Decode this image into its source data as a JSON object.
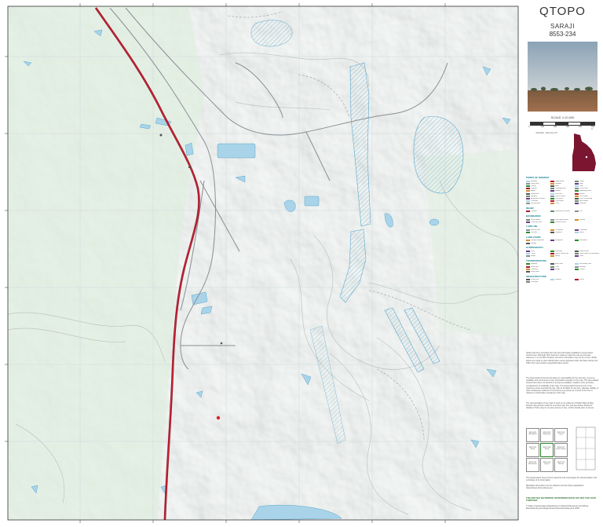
{
  "brand": {
    "title": "QTOPO",
    "map_name": "SARAJI",
    "map_code": "8553-234"
  },
  "scale": {
    "label": "SCALE 1:10,000",
    "ticks": [
      "0",
      "100",
      "200",
      "300",
      "400",
      "500 m"
    ]
  },
  "legend": {
    "sections": [
      {
        "heading": "POINTS OF INTEREST",
        "items": [
          "Building",
          "Homestead",
          "Tower",
          "Water tank",
          "Windmill",
          "Mine",
          "Quarry",
          "Bore",
          "Dam",
          "Lookout",
          "Camping area",
          "Picnic area",
          "Airport",
          "Helipad",
          "Landing ground",
          "Lighthouse",
          "Rest area",
          "School",
          "Hospital",
          "Police station",
          "Fire station",
          "Ambulance station",
          "Post office",
          "Place of worship",
          "Cemetery",
          "Trig station",
          "Spot height",
          "Survey mark",
          "Cave",
          "Waterfall"
        ]
      },
      {
        "heading": "RELIEF",
        "items": [
          "Contour",
          "Depression contour",
          "Cliff"
        ]
      },
      {
        "heading": "BOUNDARIES",
        "items": [
          "State border",
          "Local government",
          "Locality",
          "Protected area",
          "Forest reserve"
        ]
      },
      {
        "heading": "LAND USE",
        "items": [
          "Built-up area",
          "Cultivation",
          "Plantation",
          "Orchard",
          "Vineyard",
          "Sand"
        ]
      },
      {
        "heading": "LAND COVER",
        "items": [
          "Woody vegetation",
          "Mangrove",
          "Rainforest",
          "Swamp"
        ]
      },
      {
        "heading": "HYDROGRAPHY",
        "items": [
          "Lake",
          "Reservoir",
          "Watercourse",
          "Canal",
          "Saline coastal flat",
          "Land subject to inundation",
          "Rapid",
          "Spring",
          "Drain"
        ]
      },
      {
        "heading": "TRANSPORTATION",
        "items": [
          "Highway",
          "Main road",
          "Secondary road",
          "Minor road",
          "Track",
          "Railway",
          "Tramway",
          "Bridge",
          "Tunnel",
          "Ferry route"
        ]
      },
      {
        "heading": "INFRASTRUCTURE",
        "items": [
          "Power line",
          "Pipeline",
          "Fence",
          "Conveyor"
        ]
      }
    ]
  },
  "notes": {
    "disclaimer": "QTopo has been compiled from the best information available to Queensland Government. Although effort has been made to make the map as accurate reference, it is not field checked, and some information may not be current. While efforts are made to show official place names gazetted under the Place Names Act 1994, this map contains unguarded place names.",
    "liability": "The Queensland Government takes no responsibility for the accuracy, currency, reliability, and correctness of any information included on the map. The Queensland Government does not warrant or accept any liability in relation to the accuracy, completeness or suitability of the map. The Queensland Government, to the maximum extent permitted by law, will not be liable for any loss, damage, liability, or claim whatsoever suffered or incurred by any person as a result of the use or reliance on information contained in this map.",
    "access": "The representation of any road or track is not evidence of Public Right of Way. People using private roads do so at their own risk, and permission should be obtained. There may be no open access of use, confirm locally prior to access.",
    "reuse": "The Queensland Government supports and encourages the dissemination and exchange of its information.",
    "metadata": "Metadata information can be obtained via the QTopo application: https://qtopo.dnrm.qld.gov.au",
    "print": "THIS MAP MAY BE PRINTED OR REPRODUCED IN ANY WAY FOR YOUR PURPOSES",
    "copyright": "© State of Queensland (Department of Natural Resources and Mines, Manufacturing and Regional and Rural Development) 2025"
  },
  "adjoining": [
    {
      "code": "8553-231",
      "name": "Blair Athol"
    },
    {
      "code": "8553-232",
      "name": "Moranbah"
    },
    {
      "code": "8553-233",
      "name": "Dysart"
    },
    {
      "code": "8553-241",
      "name": "Saraji"
    },
    {
      "code": "8553-234",
      "name": "Saraji"
    },
    {
      "code": "8553-242",
      "name": "Peak Downs"
    },
    {
      "code": "8553-243",
      "name": "Winchester"
    },
    {
      "code": "8553-244",
      "name": "Dysart"
    },
    {
      "code": "8553-311",
      "name": "Harrow"
    }
  ],
  "colors": {
    "water": "#a9d3e8",
    "water_edge": "#5aa8cf",
    "highway": "#b0182a",
    "grid": "#d0d8de",
    "accent": "#0a7c8c",
    "state_fill": "#7b1530"
  }
}
